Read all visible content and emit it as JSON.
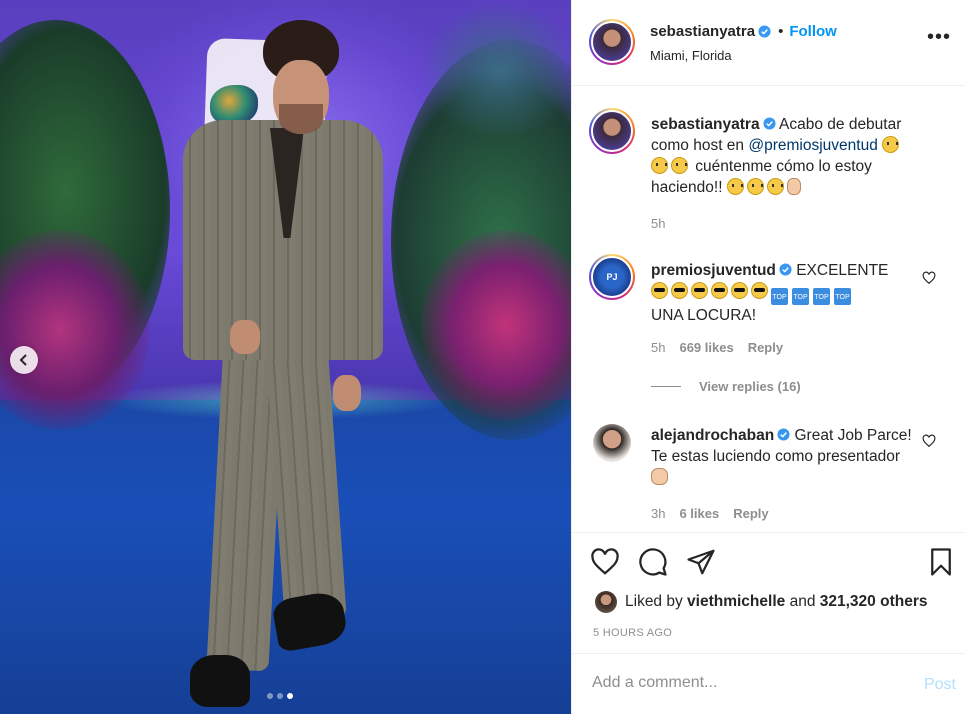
{
  "photo": {
    "carousel_dots": [
      false,
      false,
      true
    ]
  },
  "header": {
    "username": "sebastianyatra",
    "follow_label": "Follow",
    "separator": "•",
    "location": "Miami, Florida",
    "more_label": "•••"
  },
  "comments": [
    {
      "username": "sebastianyatra",
      "text_before": "Acabo de debutar como host en ",
      "mention": "@premiosjuventud",
      "text_after": " cuéntenme cómo lo estoy haciendo!!",
      "time": "5h"
    },
    {
      "username": "premiosjuventud",
      "avatar_text": "PJ",
      "text_line1": "EXCELENTE",
      "text_line3": "UNA LOCURA!",
      "top_label": "TOP",
      "time": "5h",
      "likes": "669 likes",
      "reply_label": "Reply",
      "view_replies": "View replies (16)"
    },
    {
      "username": "alejandrochaban",
      "text": "Great Job Parce! Te estas luciendo como presentador",
      "time": "3h",
      "likes": "6 likes",
      "reply_label": "Reply"
    }
  ],
  "likes": {
    "prefix": "Liked by",
    "user": "viethmichelle",
    "middle": "and",
    "others": "321,320 others"
  },
  "timestamp": "5 HOURS AGO",
  "add_comment": {
    "placeholder": "Add a comment...",
    "post_label": "Post"
  },
  "colors": {
    "link_blue": "#0095f6",
    "mention_blue": "#00376b",
    "muted": "#8e8e8e",
    "post_disabled": "#b2dffc"
  }
}
